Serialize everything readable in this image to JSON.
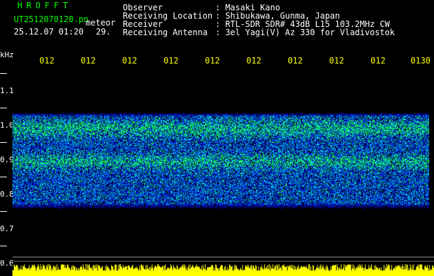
{
  "header": {
    "app_title": "HROFFT",
    "filename": "UT2512070120.pn",
    "mode": "meteor",
    "datetime": "25.12.07 01:20",
    "count": "29."
  },
  "info": [
    {
      "key": "Observer",
      "value": ": Masaki Kano"
    },
    {
      "key": "Receiving Location",
      "value": ": Shibukawa, Gunma, Japan"
    },
    {
      "key": "Receiver",
      "value": ": RTL-SDR SDR# 43dB L15 103.2MHz CW"
    },
    {
      "key": "Receiving Antenna",
      "value": ": 3el Yagi(V) Az 330 for Vladivostok"
    }
  ],
  "axis": {
    "y_unit": "kHz",
    "y_ticks": [
      "1.1",
      "1.0",
      "0.9",
      "0.8",
      "0.7",
      "0.6"
    ],
    "x_ticks": [
      "012",
      "012",
      "012",
      "012",
      "012",
      "012",
      "012",
      "012",
      "012",
      "0130"
    ]
  },
  "colors": {
    "background": "#000000",
    "title": "#00ff00",
    "text": "#ffffff",
    "x_ticks": "#ffff00",
    "spectrum_low": "#0000c8",
    "spectrum_mid": "#00c8ff",
    "spectrum_high": "#00ff60",
    "signal_bars": "#ffff00"
  }
}
